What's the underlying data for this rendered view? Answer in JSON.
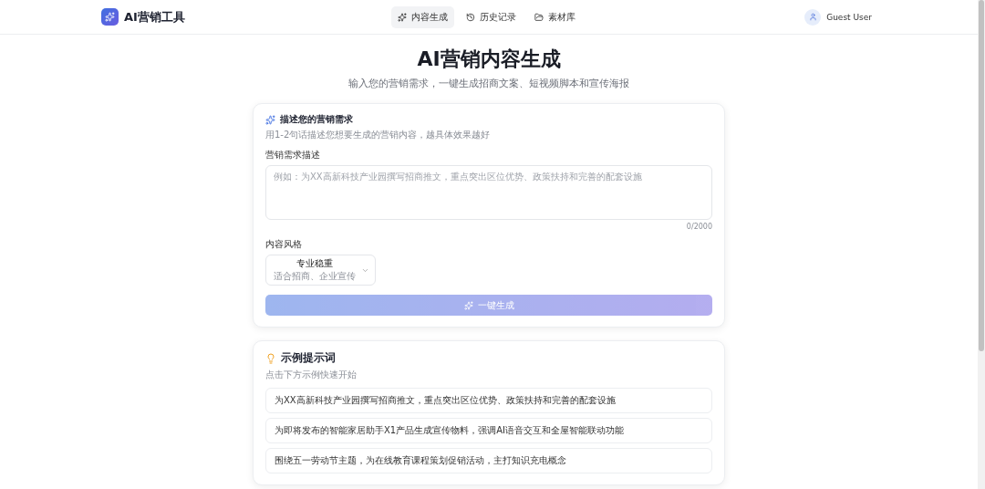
{
  "brand": {
    "name": "AI营销工具"
  },
  "nav": [
    {
      "label": "内容生成",
      "selected": true
    },
    {
      "label": "历史记录",
      "selected": false
    },
    {
      "label": "素材库",
      "selected": false
    }
  ],
  "user": {
    "name": "Guest User"
  },
  "hero": {
    "title": "AI营销内容生成",
    "subtitle": "输入您的营销需求，一键生成招商文案、短视频脚本和宣传海报"
  },
  "form_card": {
    "title": "描述您的营销需求",
    "description": "用1-2句话描述您想要生成的营销内容，越具体效果越好",
    "field_label": "营销需求描述",
    "placeholder": "例如：为XX高新科技产业园撰写招商推文，重点突出区位优势、政策扶持和完善的配套设施",
    "counter": "0/2000",
    "style_label": "内容风格",
    "style_value": "专业稳重",
    "style_hint": "适合招商、企业宣传",
    "submit": {
      "label": "一键生成",
      "disabled": true
    }
  },
  "examples_card": {
    "title": "示例提示词",
    "description": "点击下方示例快速开始",
    "items": [
      "为XX高新科技产业园撰写招商推文，重点突出区位优势、政策扶持和完善的配套设施",
      "为即将发布的智能家居助手X1产品生成宣传物料，强调AI语音交互和全屋智能联动功能",
      "围绕五一劳动节主题，为在线教育课程策划促销活动，主打知识充电概念"
    ]
  }
}
